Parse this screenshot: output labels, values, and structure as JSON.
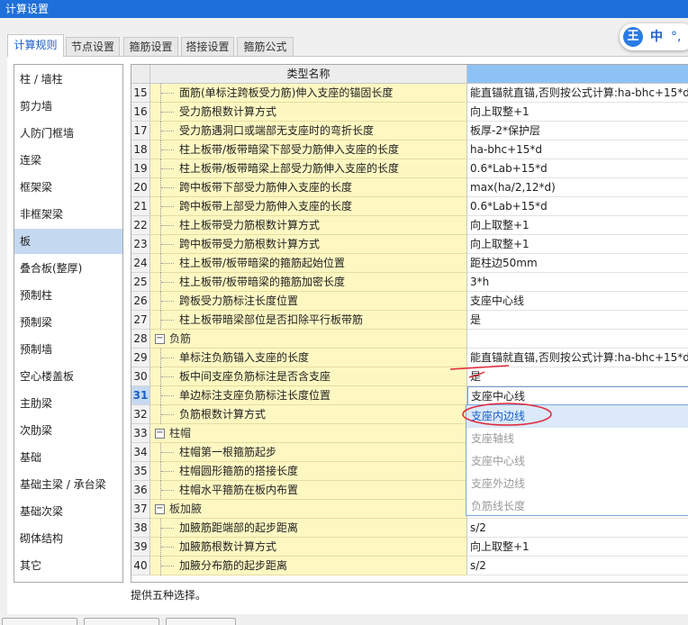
{
  "window": {
    "title": "计算设置"
  },
  "ime": {
    "logo": "王",
    "mode": "中",
    "punct": "°,"
  },
  "tabs": [
    {
      "label": "计算规则",
      "active": true
    },
    {
      "label": "节点设置",
      "active": false
    },
    {
      "label": "箍筋设置",
      "active": false
    },
    {
      "label": "搭接设置",
      "active": false
    },
    {
      "label": "箍筋公式",
      "active": false
    }
  ],
  "sidebar": {
    "selected": "板",
    "items": [
      "柱 / 墙柱",
      "剪力墙",
      "人防门框墙",
      "连梁",
      "框架梁",
      "非框架梁",
      "板",
      "叠合板(整厚)",
      "预制柱",
      "预制梁",
      "预制墙",
      "空心楼盖板",
      "主肋梁",
      "次肋梁",
      "基础",
      "基础主梁 / 承台梁",
      "基础次梁",
      "砌体结构",
      "其它"
    ]
  },
  "grid": {
    "header_name": "类型名称",
    "header_value": "",
    "rows": [
      {
        "num": "15",
        "name": "面筋(单标注跨板受力筋)伸入支座的锚固长度",
        "value": "能直锚就直锚,否则按公式计算:ha-bhc+15*d"
      },
      {
        "num": "16",
        "name": "受力筋根数计算方式",
        "value": "向上取整+1"
      },
      {
        "num": "17",
        "name": "受力筋遇洞口或端部无支座时的弯折长度",
        "value": "板厚-2*保护层"
      },
      {
        "num": "18",
        "name": "柱上板带/板带暗梁下部受力筋伸入支座的长度",
        "value": "ha-bhc+15*d"
      },
      {
        "num": "19",
        "name": "柱上板带/板带暗梁上部受力筋伸入支座的长度",
        "value": "0.6*Lab+15*d"
      },
      {
        "num": "20",
        "name": "跨中板带下部受力筋伸入支座的长度",
        "value": "max(ha/2,12*d)"
      },
      {
        "num": "21",
        "name": "跨中板带上部受力筋伸入支座的长度",
        "value": "0.6*Lab+15*d"
      },
      {
        "num": "22",
        "name": "柱上板带受力筋根数计算方式",
        "value": "向上取整+1"
      },
      {
        "num": "23",
        "name": "跨中板带受力筋根数计算方式",
        "value": "向上取整+1"
      },
      {
        "num": "24",
        "name": "柱上板带/板带暗梁的箍筋起始位置",
        "value": "距柱边50mm"
      },
      {
        "num": "25",
        "name": "柱上板带/板带暗梁的箍筋加密长度",
        "value": "3*h"
      },
      {
        "num": "26",
        "name": "跨板受力筋标注长度位置",
        "value": "支座中心线"
      },
      {
        "num": "27",
        "name": "柱上板带暗梁部位是否扣除平行板带筋",
        "value": "是"
      },
      {
        "num": "28",
        "name": "负筋",
        "value": "",
        "group": true
      },
      {
        "num": "29",
        "name": "单标注负筋锚入支座的长度",
        "value": "能直锚就直锚,否则按公式计算:ha-bhc+15*d"
      },
      {
        "num": "30",
        "name": "板中间支座负筋标注是否含支座",
        "value": "是"
      },
      {
        "num": "31",
        "name": "单边标注支座负筋标注长度位置",
        "value": "支座中心线",
        "current": true
      },
      {
        "num": "32",
        "name": "负筋根数计算方式",
        "value": ""
      },
      {
        "num": "33",
        "name": "柱帽",
        "value": "",
        "group": true
      },
      {
        "num": "34",
        "name": "柱帽第一根箍筋起步",
        "value": ""
      },
      {
        "num": "35",
        "name": "柱帽圆形箍筋的搭接长度",
        "value": ""
      },
      {
        "num": "36",
        "name": "柱帽水平箍筋在板内布置",
        "value": ""
      },
      {
        "num": "37",
        "name": "板加腋",
        "value": "",
        "group": true
      },
      {
        "num": "38",
        "name": "加腋筋距端部的起步距离",
        "value": "s/2"
      },
      {
        "num": "39",
        "name": "加腋筋根数计算方式",
        "value": "向上取整+1"
      },
      {
        "num": "40",
        "name": "加腋分布筋的起步距离",
        "value": "s/2"
      }
    ]
  },
  "dropdown": {
    "options": [
      "支座内边线",
      "支座轴线",
      "支座中心线",
      "支座外边线",
      "负筋线长度"
    ],
    "highlighted": "支座内边线"
  },
  "description": "提供五种选择。",
  "colors": {
    "titlebar": "#1e6fd9",
    "selected": "#c5d9f1",
    "name_cell": "#fdf8c2",
    "accent": "#1a5fc8",
    "annotation": "#e0283a"
  }
}
